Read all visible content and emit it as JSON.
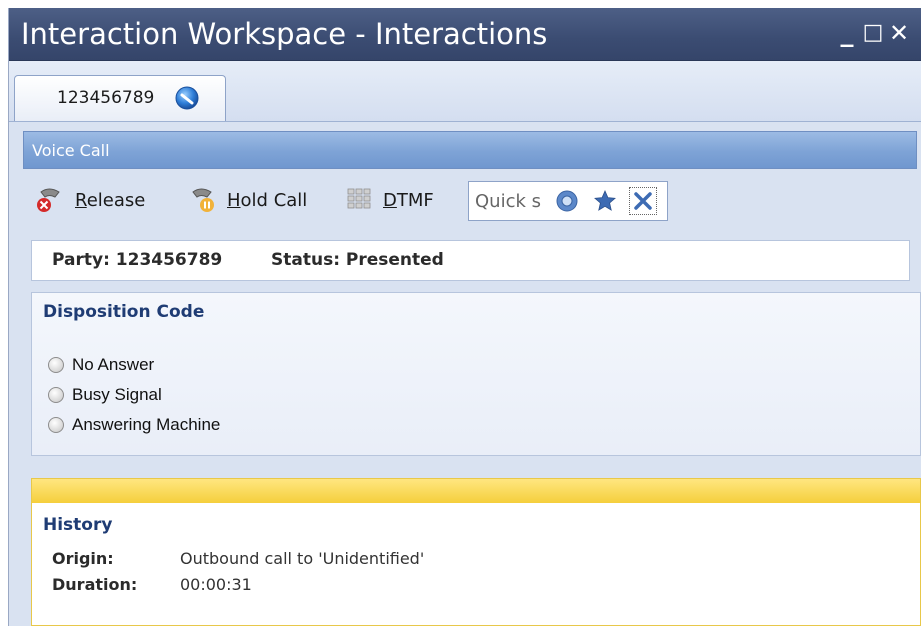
{
  "window": {
    "title": "Interaction Workspace - Interactions",
    "minimize_glyph": "_",
    "maximize_glyph": "□",
    "close_glyph": "✕"
  },
  "tab": {
    "label": "123456789",
    "icon": "voice-call-icon"
  },
  "voice_call": {
    "header": "Voice Call",
    "toolbar": {
      "release_prefix": "",
      "release_access": "R",
      "release_rest": "elease",
      "hold_access": "H",
      "hold_rest": "old Call",
      "dtmf_access": "D",
      "dtmf_rest": "TMF",
      "quick_search_value": "Quick s"
    }
  },
  "party_status": {
    "party": "Party: 123456789",
    "status": "Status: Presented"
  },
  "disposition": {
    "title": "Disposition Code",
    "options": [
      "No Answer",
      "Busy Signal",
      "Answering Machine"
    ]
  },
  "history": {
    "title": "History",
    "origin_label": "Origin:",
    "origin_value": "Outbound call to 'Unidentified'",
    "duration_label": "Duration:",
    "duration_value": "00:00:31"
  },
  "colors": {
    "titlebar": "#3b4c72",
    "section_header": "#7ea3d6",
    "heading_text": "#1f3c74",
    "history_accent": "#f5cf3c"
  }
}
